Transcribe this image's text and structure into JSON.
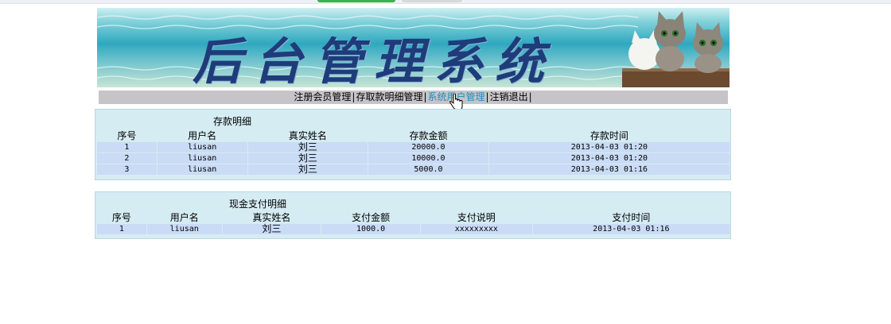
{
  "banner": {
    "title": "后台管理系统"
  },
  "nav": {
    "items": [
      {
        "label": "注册会员管理"
      },
      {
        "label": "存取款明细管理"
      },
      {
        "label": "系统用户管理"
      },
      {
        "label": "注销退出"
      }
    ],
    "separator": "|"
  },
  "deposit": {
    "title": "存款明细",
    "headers": [
      "序号",
      "用户名",
      "真实姓名",
      "存款金额",
      "存款时间"
    ],
    "rows": [
      [
        "1",
        "liusan",
        "刘三",
        "20000.0",
        "2013-04-03 01:20"
      ],
      [
        "2",
        "liusan",
        "刘三",
        "10000.0",
        "2013-04-03 01:20"
      ],
      [
        "3",
        "liusan",
        "刘三",
        "5000.0",
        "2013-04-03 01:16"
      ]
    ]
  },
  "payment": {
    "title": "现金支付明细",
    "headers": [
      "序号",
      "用户名",
      "真实姓名",
      "支付金额",
      "支付说明",
      "支付时间"
    ],
    "rows": [
      [
        "1",
        "liusan",
        "刘三",
        "1000.0",
        "xxxxxxxxx",
        "2013-04-03 01:16"
      ]
    ]
  },
  "colors": {
    "nav_bg": "#c6c4c6",
    "panel_bg": "#d5ecf3",
    "row_bg": "#c9dbf5",
    "active_link": "#1a8fc0",
    "title_text": "#1f3c7a"
  }
}
